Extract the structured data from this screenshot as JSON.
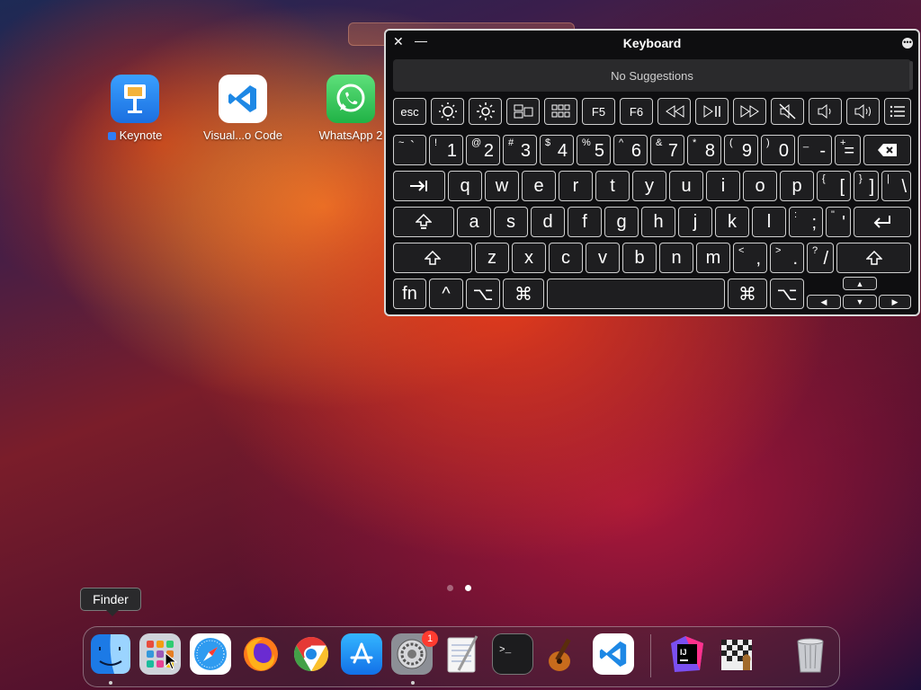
{
  "desktop": {
    "apps": [
      {
        "label": "Keynote",
        "icon": "keynote-icon"
      },
      {
        "label": "Visual...o Code",
        "icon": "vscode-icon"
      },
      {
        "label": "WhatsApp 2",
        "icon": "whatsapp-icon"
      }
    ]
  },
  "keyboard": {
    "title": "Keyboard",
    "suggestions": "No Suggestions",
    "fn_row": [
      "esc",
      "F5",
      "F6"
    ],
    "number_row": [
      {
        "sup": "~",
        "main": "`"
      },
      {
        "sup": "!",
        "main": "1"
      },
      {
        "sup": "@",
        "main": "2"
      },
      {
        "sup": "#",
        "main": "3"
      },
      {
        "sup": "$",
        "main": "4"
      },
      {
        "sup": "%",
        "main": "5"
      },
      {
        "sup": "^",
        "main": "6"
      },
      {
        "sup": "&",
        "main": "7"
      },
      {
        "sup": "*",
        "main": "8"
      },
      {
        "sup": "(",
        "main": "9"
      },
      {
        "sup": ")",
        "main": "0"
      },
      {
        "sup": "_",
        "main": "-"
      },
      {
        "sup": "+",
        "main": "="
      }
    ],
    "qwerty_row": [
      "q",
      "w",
      "e",
      "r",
      "t",
      "y",
      "u",
      "i",
      "o",
      "p"
    ],
    "qwerty_extra": [
      {
        "sup": "{",
        "main": "["
      },
      {
        "sup": "}",
        "main": "]"
      },
      {
        "sup": "|",
        "main": "\\"
      }
    ],
    "home_row": [
      "a",
      "s",
      "d",
      "f",
      "g",
      "h",
      "j",
      "k",
      "l"
    ],
    "home_extra": [
      {
        "sup": ":",
        "main": ";"
      },
      {
        "sup": "\"",
        "main": "'"
      }
    ],
    "bottom_row": [
      "z",
      "x",
      "c",
      "v",
      "b",
      "n",
      "m"
    ],
    "bottom_extra": [
      {
        "sup": "<",
        "main": ","
      },
      {
        "sup": ">",
        "main": "."
      },
      {
        "sup": "?",
        "main": "/"
      }
    ],
    "mod_row": {
      "fn": "fn",
      "control": "^",
      "option": "⌥",
      "command": "⌘"
    }
  },
  "dock": {
    "tooltip": "Finder",
    "items": [
      {
        "name": "finder",
        "icon": "finder-icon",
        "running": true
      },
      {
        "name": "launchpad",
        "icon": "launchpad-icon",
        "running": false
      },
      {
        "name": "safari",
        "icon": "safari-icon",
        "running": false
      },
      {
        "name": "firefox",
        "icon": "firefox-icon",
        "running": false
      },
      {
        "name": "chrome",
        "icon": "chrome-icon",
        "running": false
      },
      {
        "name": "app-store",
        "icon": "app-store-icon",
        "running": false
      },
      {
        "name": "system-settings",
        "icon": "system-settings-icon",
        "running": true,
        "badge": "1"
      },
      {
        "name": "textedit",
        "icon": "textedit-icon",
        "running": false
      },
      {
        "name": "terminal",
        "icon": "terminal-icon",
        "running": false
      },
      {
        "name": "garageband",
        "icon": "garageband-icon",
        "running": false
      },
      {
        "name": "vscode",
        "icon": "vscode-icon",
        "running": false
      },
      {
        "name": "intellij",
        "icon": "intellij-icon",
        "running": false
      },
      {
        "name": "chess",
        "icon": "chess-icon",
        "running": false
      },
      {
        "name": "trash",
        "icon": "trash-icon",
        "running": false
      }
    ]
  },
  "colors": {
    "accent": "#2f7df6",
    "badge": "#ff3b30"
  }
}
